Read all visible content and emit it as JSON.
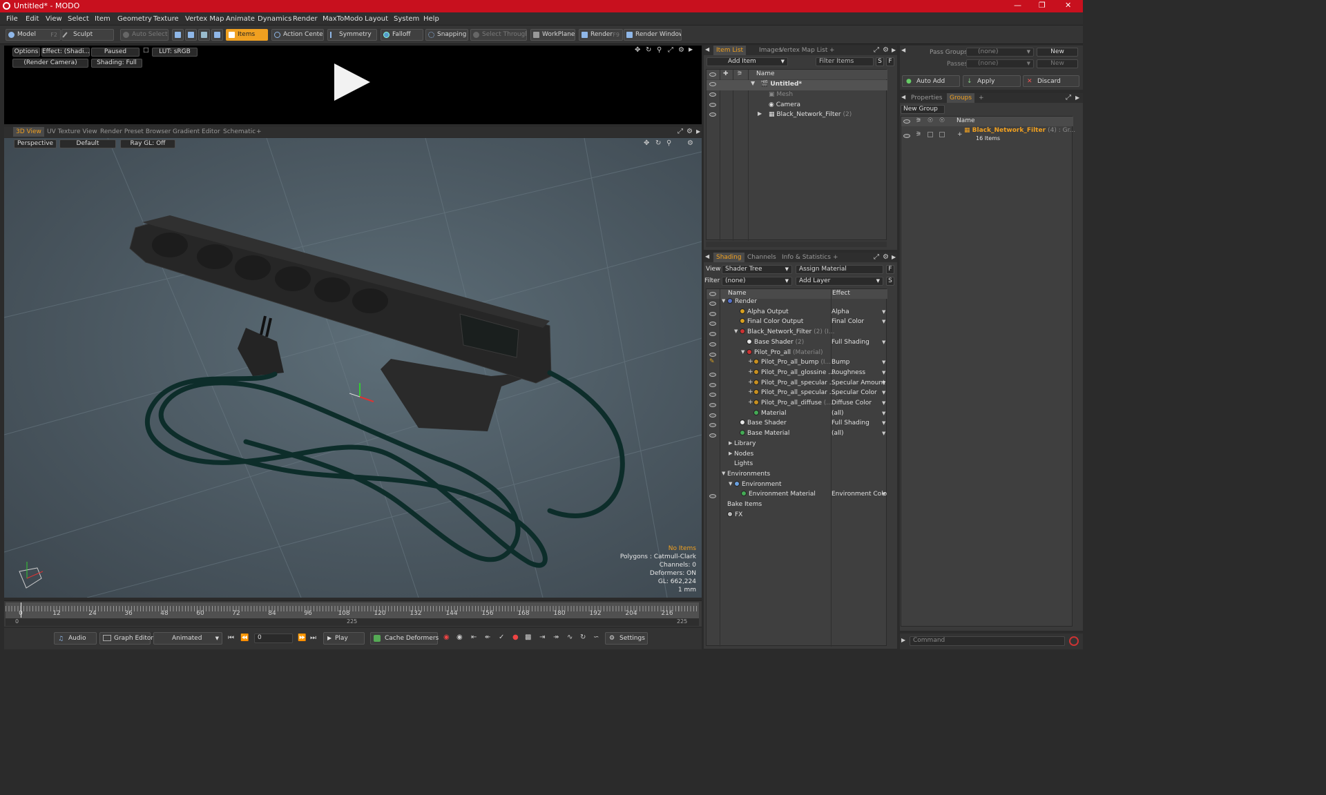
{
  "app": {
    "title": "Untitled* - MODO",
    "accent": "#f0a020",
    "titlebar_color": "#c8101e"
  },
  "menu": [
    "File",
    "Edit",
    "View",
    "Select",
    "Item",
    "Geometry",
    "Texture",
    "Vertex Map",
    "Animate",
    "Dynamics",
    "Render",
    "MaxToModo",
    "Layout",
    "System",
    "Help"
  ],
  "toolbar": {
    "model": "Model",
    "model_key": "F2",
    "sculpt": "Sculpt",
    "auto_select": "Auto Select",
    "items": "Items",
    "action_center": "Action Center",
    "symmetry": "Symmetry",
    "falloff": "Falloff",
    "snapping": "Snapping",
    "select_through": "Select Through",
    "workplane": "WorkPlane",
    "render": "Render",
    "render_key": "F9",
    "render_window": "Render Window"
  },
  "preview": {
    "options": "Options",
    "effect": "Effect: (Shadi...",
    "paused": "Paused",
    "lut": "LUT: sRGB",
    "camera": "(Render Camera)",
    "shading": "Shading: Full"
  },
  "viewport_tabs": [
    "3D View",
    "UV Texture View",
    "Render Preset Browser",
    "Gradient Editor",
    "Schematic"
  ],
  "viewport": {
    "perspective": "Perspective",
    "default": "Default",
    "raygl": "Ray GL: Off",
    "info": {
      "items": "No Items",
      "polygons": "Polygons : Catmull-Clark",
      "channels": "Channels: 0",
      "deformers": "Deformers: ON",
      "gl": "GL: 662,224",
      "unit": "1 mm"
    }
  },
  "item_list": {
    "tabs": [
      "Item List",
      "Images",
      "Vertex Map List"
    ],
    "add_item": "Add Item",
    "filter": "Filter Items",
    "s": "S",
    "f": "F",
    "name_col": "Name",
    "rows": [
      {
        "label": "Untitled*",
        "extra": ""
      },
      {
        "label": "Mesh",
        "extra": ""
      },
      {
        "label": "Camera",
        "extra": ""
      },
      {
        "label": "Black_Network_Filter",
        "extra": "(2)"
      }
    ]
  },
  "shading": {
    "tabs": [
      "Shading",
      "Channels",
      "Info & Statistics"
    ],
    "view_label": "View",
    "view_value": "Shader Tree",
    "assign": "Assign Material",
    "filter_label": "Filter",
    "filter_value": "(none)",
    "add_layer": "Add Layer",
    "name_col": "Name",
    "effect_col": "Effect",
    "rows": [
      {
        "label": "Render",
        "extra": "",
        "effect": ""
      },
      {
        "label": "Alpha Output",
        "extra": "",
        "effect": "Alpha"
      },
      {
        "label": "Final Color Output",
        "extra": "",
        "effect": "Final Color"
      },
      {
        "label": "Black_Network_Filter",
        "extra": "(2) (I...",
        "effect": ""
      },
      {
        "label": "Base Shader",
        "extra": "(2)",
        "effect": "Full Shading"
      },
      {
        "label": "Pilot_Pro_all",
        "extra": "(Material)",
        "effect": ""
      },
      {
        "label": "Pilot_Pro_all_bump",
        "extra": "(I...",
        "effect": "Bump"
      },
      {
        "label": "Pilot_Pro_all_glossine ...",
        "extra": "",
        "effect": "Roughness"
      },
      {
        "label": "Pilot_Pro_all_specular ...",
        "extra": "",
        "effect": "Specular Amount"
      },
      {
        "label": "Pilot_Pro_all_specular ...",
        "extra": "",
        "effect": "Specular Color"
      },
      {
        "label": "Pilot_Pro_all_diffuse",
        "extra": "(...",
        "effect": "Diffuse Color"
      },
      {
        "label": "Material",
        "extra": "",
        "effect": "(all)"
      },
      {
        "label": "Base Shader",
        "extra": "",
        "effect": "Full Shading"
      },
      {
        "label": "Base Material",
        "extra": "",
        "effect": "(all)"
      },
      {
        "label": "Library",
        "extra": "",
        "effect": ""
      },
      {
        "label": "Nodes",
        "extra": "",
        "effect": ""
      },
      {
        "label": "Lights",
        "extra": "",
        "effect": ""
      },
      {
        "label": "Environments",
        "extra": "",
        "effect": ""
      },
      {
        "label": "Environment",
        "extra": "",
        "effect": ""
      },
      {
        "label": "Environment Material",
        "extra": "",
        "effect": "Environment Color"
      },
      {
        "label": "Bake Items",
        "extra": "",
        "effect": ""
      },
      {
        "label": "FX",
        "extra": "",
        "effect": ""
      }
    ]
  },
  "right": {
    "pass_groups": "Pass Groups",
    "passes": "Passes",
    "none": "(none)",
    "new": "New",
    "auto_add": "Auto Add",
    "apply": "Apply",
    "discard": "Discard",
    "tabs": [
      "Properties",
      "Groups"
    ],
    "new_group": "New Group",
    "name_col": "Name",
    "group_name": "Black_Network_Filter",
    "group_extra": "(4) : Gr...",
    "group_count": "16 Items"
  },
  "timeline": {
    "ticks": [
      "0",
      "12",
      "24",
      "36",
      "48",
      "60",
      "72",
      "84",
      "96",
      "108",
      "120",
      "132",
      "144",
      "156",
      "168",
      "180",
      "192",
      "204",
      "216"
    ],
    "start": "0",
    "mid": "225",
    "end": "225"
  },
  "bottom": {
    "audio": "Audio",
    "graph_editor": "Graph Editor",
    "animated": "Animated",
    "frame": "0",
    "play": "Play",
    "cache": "Cache Deformers",
    "settings": "Settings",
    "command": "Command"
  }
}
